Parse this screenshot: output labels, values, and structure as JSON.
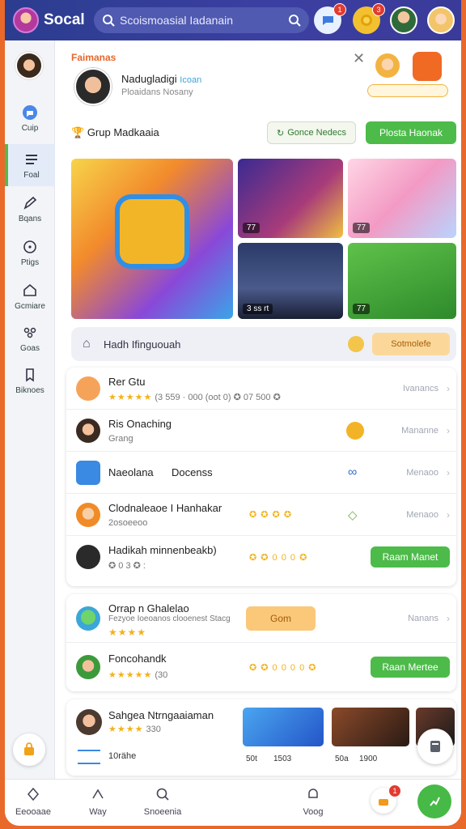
{
  "app": {
    "brand": "Socal"
  },
  "search": {
    "text": "Scoismoasial Iadanain"
  },
  "topbar": {
    "badges": [
      "1",
      "3",
      "",
      ""
    ]
  },
  "sidebar": {
    "items": [
      {
        "label": "Cuip",
        "icon": "chat-bubble-icon"
      },
      {
        "label": "Foal",
        "icon": "feed-list-icon"
      },
      {
        "label": "Bqans",
        "icon": "pen-icon"
      },
      {
        "label": "Ptigs",
        "icon": "circle-dot-icon"
      },
      {
        "label": "Gcmiare",
        "icon": "home-icon"
      },
      {
        "label": "Goas",
        "icon": "group-icon"
      },
      {
        "label": "Biknoes",
        "icon": "bookmark-icon"
      }
    ]
  },
  "profile": {
    "section": "Faimanas",
    "name": "Nadugladigi",
    "name_link": "Icoan",
    "sub": "Ploaidans Nosany"
  },
  "group_header": {
    "title": "Grup Madkaaia",
    "button_outline": "Gonce Nedecs",
    "button_green": "Plosta Haonak"
  },
  "tiles": [
    {
      "caption": ""
    },
    {
      "caption": "77"
    },
    {
      "caption": "77"
    },
    {
      "caption": "3 ss rt"
    },
    {
      "caption": "77"
    }
  ],
  "banner": {
    "title": "Hadh Ifinguouah",
    "pill": "Sotmolefe"
  },
  "list1": [
    {
      "title": "Rer Gtu",
      "stars": "★★★★★",
      "sub": "(3 559 · 000 (oot 0)  ✪ 07 500 ✪",
      "right": "Ivanancs"
    },
    {
      "title": "Ris Onaching",
      "sub": "Grang",
      "right": "Mananne"
    },
    {
      "title": "Naeolana",
      "title2": "Docenss",
      "right": "Menaoo"
    },
    {
      "title": "Clodnaleaoe I Hanhakar",
      "sub": "2osoeeoo",
      "stars": "✪ ✪ ✪ ✪",
      "right": "Menaoo"
    },
    {
      "title": "Hadikah minnenbeakb)",
      "sub": "✪ 0 3 ✪ :",
      "stars": "✪ ✪ 0 0 0 ✪",
      "button": "Raam Manet"
    }
  ],
  "list2": [
    {
      "title": "Orrap n Ghalelao",
      "sub": "Fezyoe   Ioeoanos clooenest Stacg",
      "stars": "★★★★",
      "pill": "Gom",
      "right": "Nanans"
    },
    {
      "title": "Foncohandk",
      "stars": "★★★★★",
      "sub": "(30",
      "stars2": "✪ ✪ 0 0 0 0 ✪",
      "button": "Raan Mertee"
    }
  ],
  "list3": {
    "title": "Sahgea Ntrngaaiaman",
    "stars": "★★★★",
    "count": "330",
    "sub": "10rähe",
    "thumbs": [
      {
        "left": "50t",
        "right": "1503"
      },
      {
        "left": "50a",
        "right": "1900"
      }
    ]
  },
  "bottom_nav": [
    {
      "label": "Eeooaae",
      "icon": "diamond-icon"
    },
    {
      "label": "Way",
      "icon": "share-icon"
    },
    {
      "label": "Snoeenia",
      "icon": "search-icon"
    },
    {
      "label": "Voog",
      "icon": "bell-icon"
    }
  ],
  "fab_badge": "1"
}
